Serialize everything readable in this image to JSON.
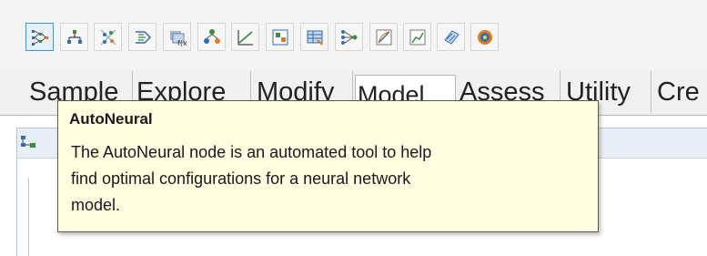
{
  "toolbar": {
    "icons": [
      "autoneural-icon",
      "sample-icon",
      "filter-icon",
      "transform-icon",
      "impute-icon",
      "cluster-icon",
      "regression-icon",
      "decision-tree-icon",
      "tree-grid-icon",
      "neural-network-icon",
      "model-compare-icon",
      "score-chart-icon",
      "dmneural-icon",
      "ensemble-icon"
    ]
  },
  "tabs": [
    {
      "label": "Sample"
    },
    {
      "label": "Explore"
    },
    {
      "label": "Modify"
    },
    {
      "label": "Model"
    },
    {
      "label": "Assess"
    },
    {
      "label": "Utility"
    },
    {
      "label": "Cre"
    }
  ],
  "workspace": {
    "icon": "diagram-icon"
  },
  "tooltip": {
    "title": "AutoNeural",
    "text_line1": "The AutoNeural node is an automated tool to help",
    "text_line2": "find optimal configurations for a neural network",
    "text_line3": "model."
  },
  "colors": {
    "tooltip_bg": "#fefee0",
    "active_border": "#4a90d9",
    "icon_blue": "#2f6fb5",
    "icon_green": "#3a8f3a",
    "icon_orange": "#e07a1f"
  }
}
